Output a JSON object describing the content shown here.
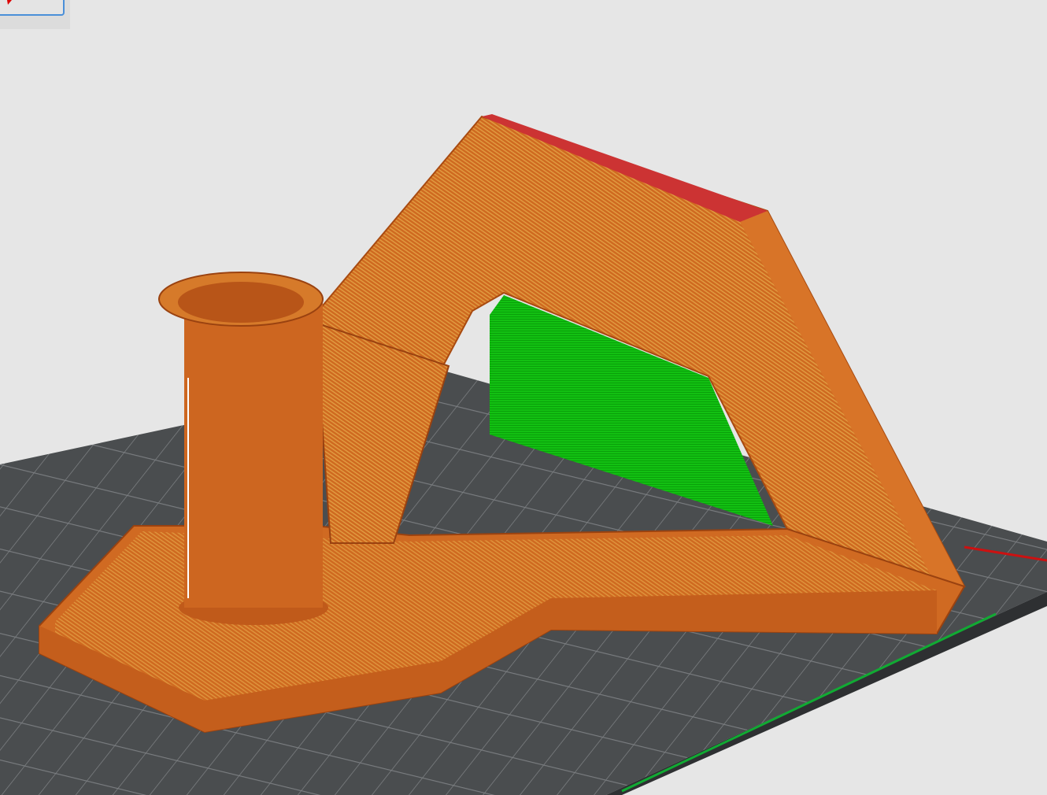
{
  "app": {
    "view": "gcode-preview"
  },
  "colors": {
    "background": "#e6e6e6",
    "bed": "#4a4d4f",
    "bed_grid": "#7a7d80",
    "perimeter": "#d2691e",
    "perimeter_dark": "#b8561a",
    "solid_infill": "#cc3333",
    "support": "#10c010",
    "axis_x": "#cc1111",
    "axis_y": "#11aa33",
    "toolbar_border": "#4a8fd8"
  }
}
